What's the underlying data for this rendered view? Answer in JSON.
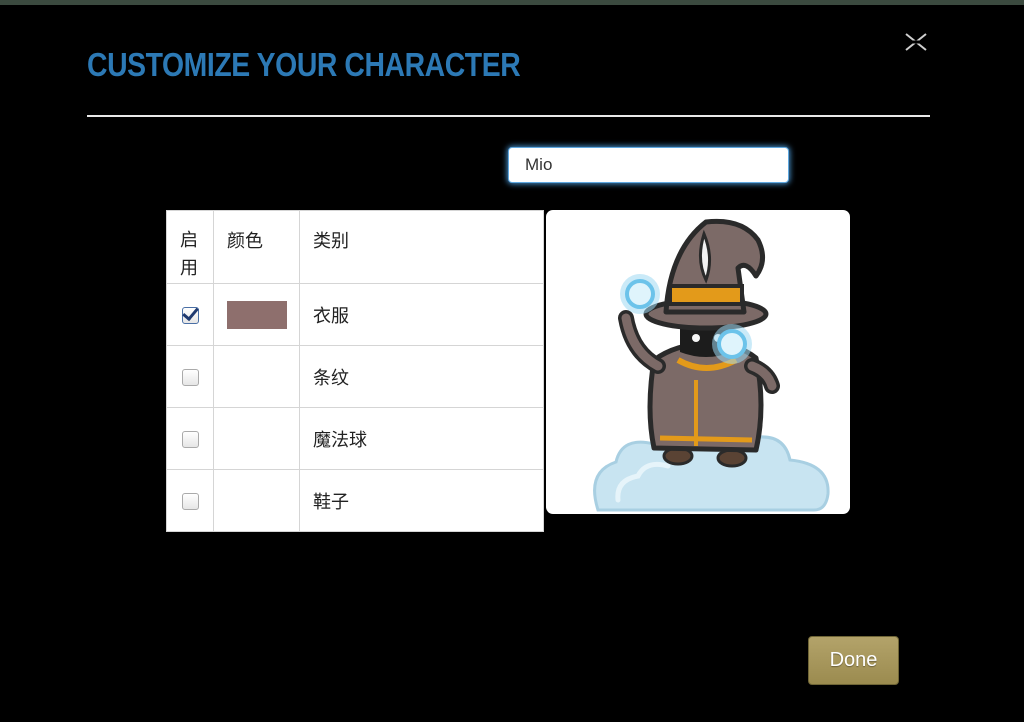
{
  "dialog": {
    "title": "CUSTOMIZE YOUR CHARACTER",
    "close_icon": "close-icon",
    "name_value": "Mio",
    "done_label": "Done"
  },
  "table": {
    "headers": {
      "enable": "启用",
      "color": "颜色",
      "type": "类别"
    },
    "rows": [
      {
        "checked": true,
        "color": "#8e6f6d",
        "label": "衣服"
      },
      {
        "checked": false,
        "color": "",
        "label": "条纹"
      },
      {
        "checked": false,
        "color": "",
        "label": "魔法球"
      },
      {
        "checked": false,
        "color": "",
        "label": "鞋子"
      }
    ]
  },
  "preview": {
    "icon": "wizard-character-illustration"
  },
  "colors": {
    "title": "#2c79b5",
    "done_button": "#a69659",
    "input_focus": "#5fa8e0",
    "clothing_swatch": "#8e6f6d"
  }
}
